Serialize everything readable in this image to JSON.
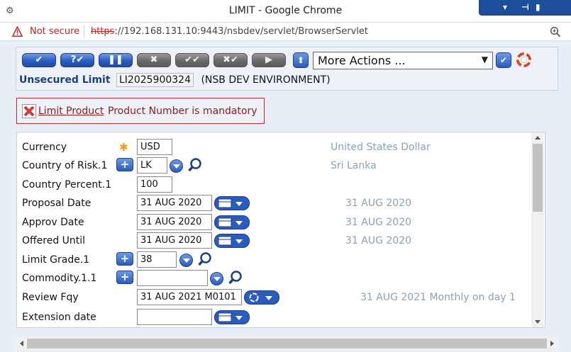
{
  "window": {
    "title": "LIMIT - Google Chrome"
  },
  "address": {
    "security": "Not secure",
    "scheme": "https",
    "url_rest": "://192.168.131.10:9443/nsbdev/servlet/BrowserServlet"
  },
  "toolbar": {
    "actions_value": "More Actions ...",
    "buttons": [
      "commit",
      "validate",
      "hold",
      "delete",
      "authorise",
      "reverse",
      "next",
      "up"
    ]
  },
  "header": {
    "label": "Unsecured Limit",
    "code": "LI2025900324",
    "env": "(NSB DEV ENVIRONMENT)"
  },
  "error": {
    "field": "Limit Product",
    "message": "Product Number is mandatory"
  },
  "form": {
    "currency": {
      "label": "Currency",
      "value": "USD",
      "desc": "United States Dollar"
    },
    "country_risk": {
      "label": "Country of Risk.1",
      "value": "LK",
      "desc": "Sri Lanka"
    },
    "country_percent": {
      "label": "Country Percent.1",
      "value": "100"
    },
    "proposal_date": {
      "label": "Proposal Date",
      "value": "31 AUG 2020",
      "desc": "31 AUG 2020"
    },
    "approv_date": {
      "label": "Approv Date",
      "value": "31 AUG 2020",
      "desc": "31 AUG 2020"
    },
    "offered_until": {
      "label": "Offered Until",
      "value": "31 AUG 2020",
      "desc": "31 AUG 2020"
    },
    "limit_grade": {
      "label": "Limit Grade.1",
      "value": "38"
    },
    "commodity": {
      "label": "Commodity.1.1",
      "value": ""
    },
    "review_fqy": {
      "label": "Review Fqy",
      "value": "31 AUG 2021 M0101",
      "desc": "31 AUG 2021 Monthly on day 1"
    },
    "extension_date": {
      "label": "Extension date",
      "value": ""
    }
  },
  "colors": {
    "accent": "#2a5cc0",
    "error": "#8b1a1a",
    "desc": "#8aa1bd",
    "required": "#f39c12"
  }
}
